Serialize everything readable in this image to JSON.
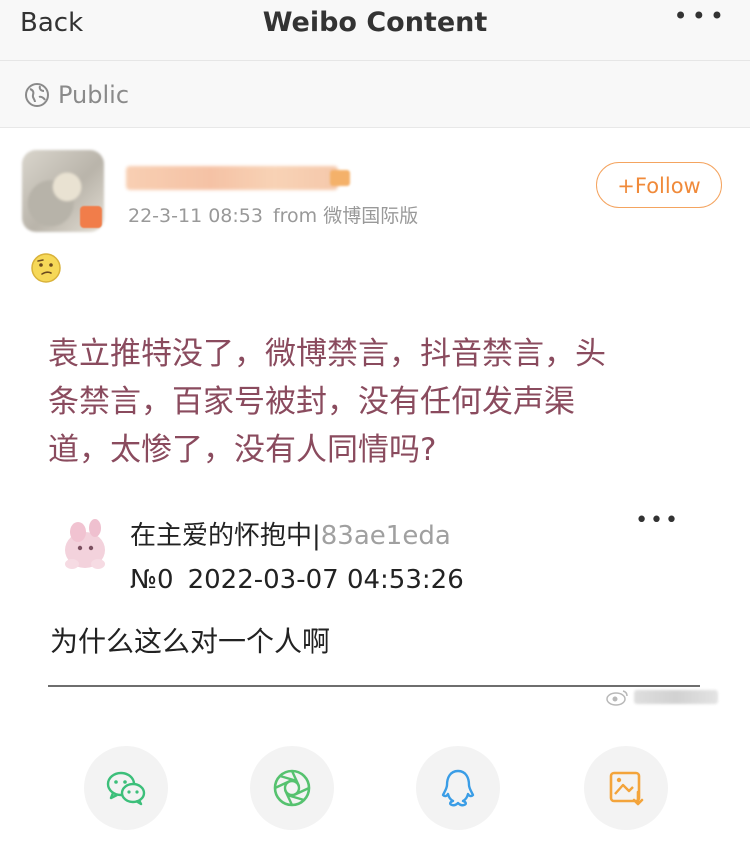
{
  "nav": {
    "back_label": "Back",
    "title": "Weibo Content",
    "more_icon": "more-horizontal-icon",
    "more_glyph": "•••"
  },
  "visibility": {
    "icon": "globe-icon",
    "label": "Public"
  },
  "post": {
    "meta": {
      "time": "22-3-11 08:53",
      "source": "from 微博国际版"
    },
    "follow_label": "+Follow",
    "emoji_icon": "thinking-face-icon",
    "text_lines": [
      "袁立推特没了，微博禁言，抖音禁言，头",
      "条禁言，百家号被封，没有任何发声渠",
      "道，太惨了，没有人同情吗?"
    ]
  },
  "comment": {
    "username": "在主爱的怀抱中|",
    "user_suffix": "83ae1eda",
    "number": "№0",
    "datetime": "2022-03-07 04:53:26",
    "more_glyph": "•••",
    "text": "为什么这么对一个人啊"
  },
  "share": [
    {
      "icon": "wechat-icon",
      "color": "#3cbf7a"
    },
    {
      "icon": "moments-icon",
      "color": "#56c26f"
    },
    {
      "icon": "qq-icon",
      "color": "#3a9de6"
    },
    {
      "icon": "save-image-icon",
      "color": "#f3a43b"
    }
  ],
  "colors": {
    "accent": "#f08a3a",
    "post_text": "#8a4b5e",
    "meta_text": "#999999"
  }
}
